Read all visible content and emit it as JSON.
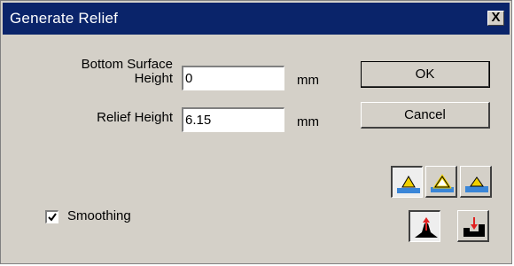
{
  "window": {
    "title": "Generate Relief",
    "close_glyph": "X"
  },
  "fields": {
    "bottom_surface": {
      "label_line1": "Bottom Surface",
      "label_line2": "Height",
      "value": "0",
      "unit": "mm"
    },
    "relief_height": {
      "label": "Relief Height",
      "value": "6.15",
      "unit": "mm"
    }
  },
  "buttons": {
    "ok": "OK",
    "cancel": "Cancel"
  },
  "smoothing": {
    "label": "Smoothing",
    "checked": true
  },
  "tool_groups": {
    "relief_shape": [
      {
        "icon": "relief-filled-icon",
        "pressed": true
      },
      {
        "icon": "relief-outline-icon",
        "pressed": false
      },
      {
        "icon": "relief-flat-icon",
        "pressed": false
      }
    ],
    "direction": [
      {
        "icon": "raise-arrow-icon",
        "pressed": true
      },
      {
        "icon": "engrave-arrow-icon",
        "pressed": false
      }
    ]
  },
  "colors": {
    "titlebar": "#0a246a",
    "face": "#d4d0c8",
    "icon_yellow": "#f0d000",
    "icon_blue": "#3a86d8",
    "icon_red": "#e02020"
  }
}
